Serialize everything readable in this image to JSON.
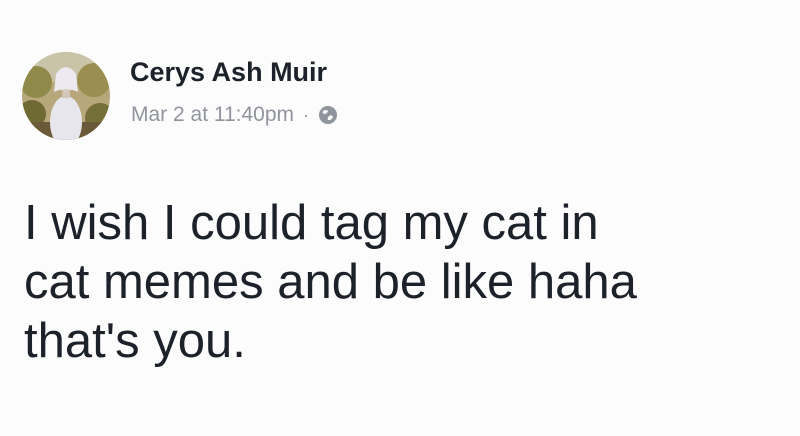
{
  "post": {
    "author": "Cerys Ash Muir",
    "timestamp": "Mar 2 at 11:40pm",
    "separator": "·",
    "privacy_icon": "globe-icon",
    "text_lines": [
      "I wish I could tag my cat in",
      "cat memes and be like haha",
      "that's you."
    ]
  },
  "colors": {
    "background": "#fcfcfc",
    "name_text": "#1d2129",
    "meta_text": "#90949c",
    "body_text": "#1d2129"
  }
}
